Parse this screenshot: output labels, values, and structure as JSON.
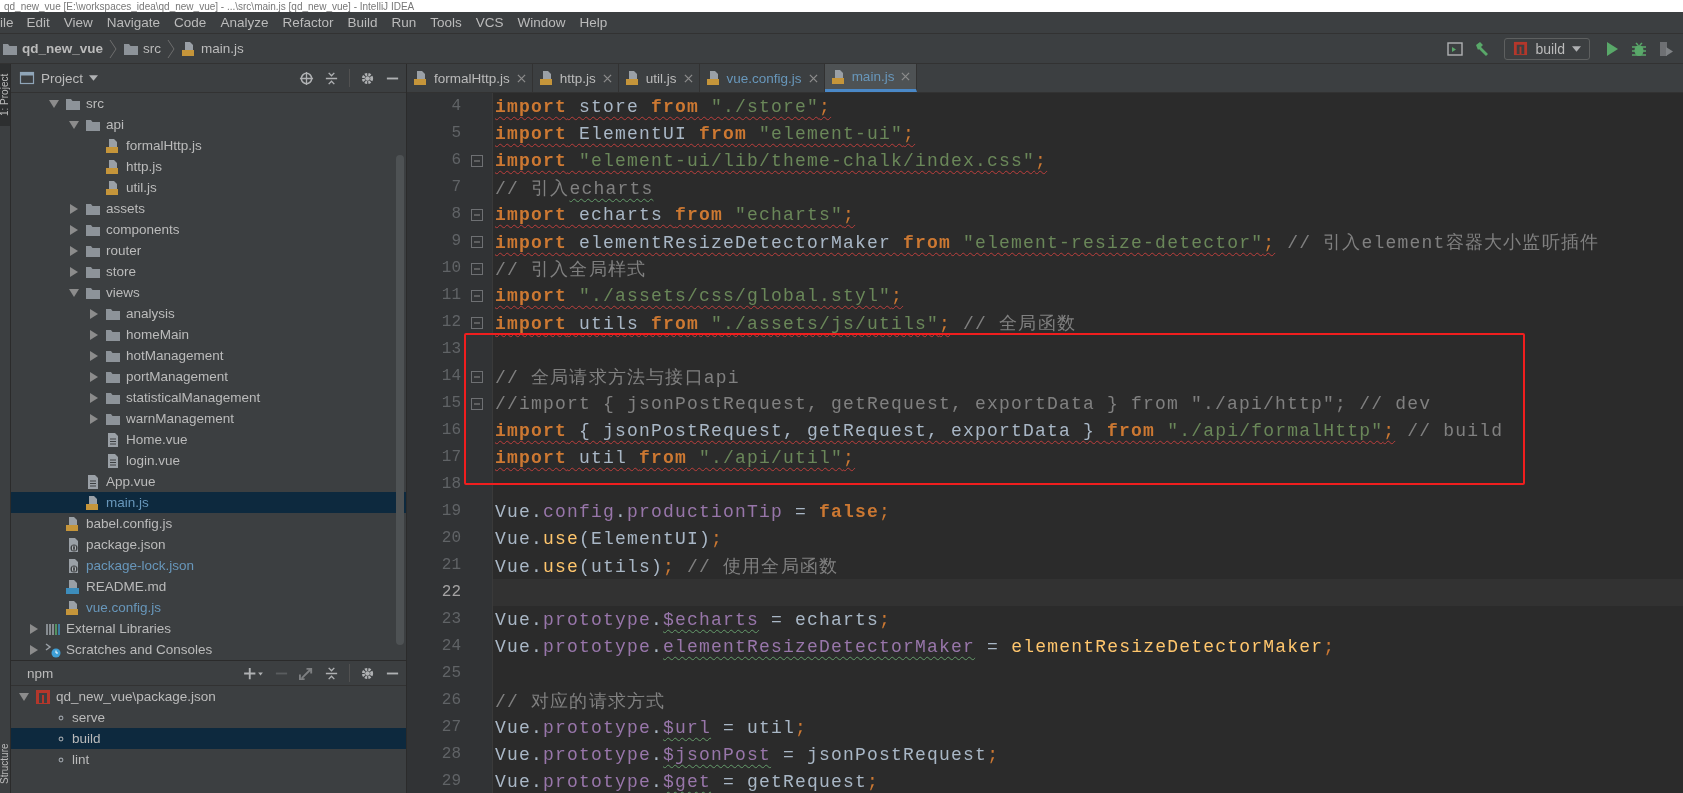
{
  "window": {
    "title": "qd_new_vue [E:\\workspaces_idea\\qd_new_vue] - ...\\src\\main.js [qd_new_vue] - IntelliJ IDEA"
  },
  "menu": [
    "ile",
    "Edit",
    "View",
    "Navigate",
    "Code",
    "Analyze",
    "Refactor",
    "Build",
    "Run",
    "Tools",
    "VCS",
    "Window",
    "Help"
  ],
  "breadcrumb": [
    {
      "kind": "project",
      "label": "qd_new_vue"
    },
    {
      "kind": "folder",
      "label": "src"
    },
    {
      "kind": "js",
      "label": "main.js"
    }
  ],
  "run_config": {
    "label": "build"
  },
  "side_tabs": {
    "top": "1: Project",
    "bottom": "Structure"
  },
  "project_panel": {
    "title": "Project"
  },
  "project_tree": {
    "items": [
      {
        "kind": "folder",
        "label": "src",
        "expanded": true,
        "selected": false,
        "children": [
          {
            "kind": "folder",
            "label": "api",
            "expanded": true,
            "selected": false,
            "children": [
              {
                "kind": "js",
                "label": "formalHttp.js",
                "selected": false,
                "modified": false
              },
              {
                "kind": "js",
                "label": "http.js",
                "selected": false,
                "modified": false
              },
              {
                "kind": "js",
                "label": "util.js",
                "selected": false,
                "modified": false
              }
            ]
          },
          {
            "kind": "folder",
            "label": "assets",
            "expanded": false,
            "selected": false
          },
          {
            "kind": "folder",
            "label": "components",
            "expanded": false,
            "selected": false
          },
          {
            "kind": "folder",
            "label": "router",
            "expanded": false,
            "selected": false
          },
          {
            "kind": "folder",
            "label": "store",
            "expanded": false,
            "selected": false
          },
          {
            "kind": "folder",
            "label": "views",
            "expanded": true,
            "selected": false,
            "children": [
              {
                "kind": "folder",
                "label": "analysis",
                "expanded": false,
                "selected": false
              },
              {
                "kind": "folder",
                "label": "homeMain",
                "expanded": false,
                "selected": false
              },
              {
                "kind": "folder",
                "label": "hotManagement",
                "expanded": false,
                "selected": false
              },
              {
                "kind": "folder",
                "label": "portManagement",
                "expanded": false,
                "selected": false
              },
              {
                "kind": "folder",
                "label": "statisticalManagement",
                "expanded": false,
                "selected": false
              },
              {
                "kind": "folder",
                "label": "warnManagement",
                "expanded": false,
                "selected": false
              },
              {
                "kind": "vue",
                "label": "Home.vue",
                "selected": false,
                "modified": false
              },
              {
                "kind": "vue",
                "label": "login.vue",
                "selected": false,
                "modified": false
              }
            ]
          },
          {
            "kind": "vue",
            "label": "App.vue",
            "selected": false,
            "modified": false
          },
          {
            "kind": "js",
            "label": "main.js",
            "selected": true,
            "modified": true
          }
        ]
      },
      {
        "kind": "js",
        "label": "babel.config.js",
        "selected": false,
        "modified": false
      },
      {
        "kind": "json",
        "label": "package.json",
        "selected": false,
        "modified": false
      },
      {
        "kind": "json",
        "label": "package-lock.json",
        "selected": false,
        "modified": true
      },
      {
        "kind": "md",
        "label": "README.md",
        "selected": false,
        "modified": false
      },
      {
        "kind": "js",
        "label": "vue.config.js",
        "selected": false,
        "modified": true
      }
    ],
    "extra_items": [
      {
        "kind": "library",
        "label": "External Libraries",
        "expanded": false,
        "selected": false
      },
      {
        "kind": "scratch",
        "label": "Scratches and Consoles",
        "expanded": false,
        "selected": false
      }
    ]
  },
  "npm_panel": {
    "title": "npm",
    "items": [
      {
        "kind": "package",
        "label": "qd_new_vue\\package.json",
        "expanded": true,
        "selected": false,
        "children": [
          {
            "kind": "script",
            "label": "serve",
            "selected": false
          },
          {
            "kind": "script",
            "label": "build",
            "selected": true
          },
          {
            "kind": "script",
            "label": "lint",
            "selected": false
          }
        ]
      }
    ]
  },
  "tabs": [
    {
      "label": "formalHttp.js",
      "selected": false,
      "modified": false
    },
    {
      "label": "http.js",
      "selected": false,
      "modified": false
    },
    {
      "label": "util.js",
      "selected": false,
      "modified": false
    },
    {
      "label": "vue.config.js",
      "selected": false,
      "modified": true
    },
    {
      "label": "main.js",
      "selected": true,
      "modified": true
    }
  ],
  "code_lines": [
    {
      "number": "4",
      "error": true,
      "tokens": [
        {
          "kind": "keyword",
          "text": "import"
        },
        {
          "kind": "plain",
          "text": " store "
        },
        {
          "kind": "keyword",
          "text": "from"
        },
        {
          "kind": "string",
          "text": " \"./store\""
        },
        {
          "kind": "punct",
          "text": ";"
        }
      ]
    },
    {
      "number": "5",
      "error": true,
      "tokens": [
        {
          "kind": "keyword",
          "text": "import"
        },
        {
          "kind": "plain",
          "text": " ElementUI "
        },
        {
          "kind": "keyword",
          "text": "from"
        },
        {
          "kind": "string",
          "text": " \"element-ui\""
        },
        {
          "kind": "punct",
          "text": ";"
        }
      ]
    },
    {
      "number": "6",
      "error": true,
      "fold": true,
      "tokens": [
        {
          "kind": "keyword",
          "text": "import"
        },
        {
          "kind": "string",
          "text": " \"element-ui/lib/theme-chalk/index.css\""
        },
        {
          "kind": "punct",
          "text": ";"
        }
      ]
    },
    {
      "number": "7",
      "tokens": [
        {
          "kind": "comment",
          "text": "// 引入"
        },
        {
          "kind": "comment",
          "text": "echarts",
          "typo": true
        }
      ]
    },
    {
      "number": "8",
      "error": true,
      "fold": true,
      "tokens": [
        {
          "kind": "keyword",
          "text": "import"
        },
        {
          "kind": "plain",
          "text": " echarts "
        },
        {
          "kind": "keyword",
          "text": "from"
        },
        {
          "kind": "string",
          "text": " \"echarts\""
        },
        {
          "kind": "punct",
          "text": ";"
        }
      ]
    },
    {
      "number": "9",
      "error": true,
      "fold": true,
      "tokens": [
        {
          "kind": "keyword",
          "text": "import"
        },
        {
          "kind": "plain",
          "text": " elementResizeDetectorMaker "
        },
        {
          "kind": "keyword",
          "text": "from"
        },
        {
          "kind": "string",
          "text": " \"element-resize-detector\""
        },
        {
          "kind": "punct",
          "text": ";"
        },
        {
          "kind": "comment",
          "text": " // 引入element容器大小监听插件"
        }
      ]
    },
    {
      "number": "10",
      "fold": true,
      "tokens": [
        {
          "kind": "comment",
          "text": "// 引入全局样式"
        }
      ]
    },
    {
      "number": "11",
      "error": true,
      "fold": true,
      "tokens": [
        {
          "kind": "keyword",
          "text": "import"
        },
        {
          "kind": "string",
          "text": " \"./assets/css/global.styl\""
        },
        {
          "kind": "punct",
          "text": ";"
        }
      ]
    },
    {
      "number": "12",
      "error": true,
      "fold": true,
      "tokens": [
        {
          "kind": "keyword",
          "text": "import"
        },
        {
          "kind": "plain",
          "text": " utils "
        },
        {
          "kind": "keyword",
          "text": "from"
        },
        {
          "kind": "string",
          "text": " \"./assets/js/utils\""
        },
        {
          "kind": "punct",
          "text": ";"
        },
        {
          "kind": "comment",
          "text": " // 全局函数"
        }
      ]
    },
    {
      "number": "13",
      "boxed": true
    },
    {
      "number": "14",
      "boxed": true,
      "fold": true,
      "tokens": [
        {
          "kind": "comment",
          "text": "// 全局请求方法与接口api"
        }
      ]
    },
    {
      "number": "15",
      "boxed": true,
      "fold": true,
      "tokens": [
        {
          "kind": "comment",
          "text": "//import { jsonPostRequest, getRequest, exportData } from \"./api/http\"; // dev"
        }
      ]
    },
    {
      "number": "16",
      "boxed": true,
      "error": true,
      "tokens": [
        {
          "kind": "keyword",
          "text": "import"
        },
        {
          "kind": "plain",
          "text": " { jsonPostRequest, getRequest, exportData } "
        },
        {
          "kind": "keyword",
          "text": "from"
        },
        {
          "kind": "string",
          "text": " \"./api/formalHttp\""
        },
        {
          "kind": "punct",
          "text": ";"
        },
        {
          "kind": "comment",
          "text": " // build"
        }
      ]
    },
    {
      "number": "17",
      "boxed": true,
      "error": true,
      "tokens": [
        {
          "kind": "keyword",
          "text": "import"
        },
        {
          "kind": "plain",
          "text": " util "
        },
        {
          "kind": "keyword",
          "text": "from"
        },
        {
          "kind": "string",
          "text": " \"./api/util\""
        },
        {
          "kind": "punct",
          "text": ";"
        }
      ]
    },
    {
      "number": "18"
    },
    {
      "number": "19",
      "tokens": [
        {
          "kind": "plain",
          "text": "Vue."
        },
        {
          "kind": "property",
          "text": "config"
        },
        {
          "kind": "plain",
          "text": "."
        },
        {
          "kind": "property",
          "text": "productionTip"
        },
        {
          "kind": "plain",
          "text": " = "
        },
        {
          "kind": "keyword",
          "text": "false"
        },
        {
          "kind": "punct",
          "text": ";"
        }
      ]
    },
    {
      "number": "20",
      "tokens": [
        {
          "kind": "plain",
          "text": "Vue."
        },
        {
          "kind": "function",
          "text": "use"
        },
        {
          "kind": "plain",
          "text": "(ElementUI)"
        },
        {
          "kind": "punct",
          "text": ";"
        }
      ]
    },
    {
      "number": "21",
      "tokens": [
        {
          "kind": "plain",
          "text": "Vue."
        },
        {
          "kind": "function",
          "text": "use"
        },
        {
          "kind": "plain",
          "text": "(utils)"
        },
        {
          "kind": "punct",
          "text": ";"
        },
        {
          "kind": "comment",
          "text": " // 使用全局函数"
        }
      ]
    },
    {
      "number": "22",
      "current": true
    },
    {
      "number": "23",
      "tokens": [
        {
          "kind": "plain",
          "text": "Vue."
        },
        {
          "kind": "property",
          "text": "prototype"
        },
        {
          "kind": "plain",
          "text": "."
        },
        {
          "kind": "property",
          "text": "$echarts",
          "typo": true
        },
        {
          "kind": "plain",
          "text": " = echarts"
        },
        {
          "kind": "punct",
          "text": ";"
        }
      ]
    },
    {
      "number": "24",
      "tokens": [
        {
          "kind": "plain",
          "text": "Vue."
        },
        {
          "kind": "property",
          "text": "prototype"
        },
        {
          "kind": "plain",
          "text": "."
        },
        {
          "kind": "property",
          "text": "elementResizeDetectorMaker",
          "typo": true
        },
        {
          "kind": "plain",
          "text": " = "
        },
        {
          "kind": "function",
          "text": "elementResizeDetectorMaker"
        },
        {
          "kind": "punct",
          "text": ";"
        }
      ]
    },
    {
      "number": "25"
    },
    {
      "number": "26",
      "tokens": [
        {
          "kind": "comment",
          "text": "// 对应的请求方式"
        }
      ]
    },
    {
      "number": "27",
      "tokens": [
        {
          "kind": "plain",
          "text": "Vue."
        },
        {
          "kind": "property",
          "text": "prototype"
        },
        {
          "kind": "plain",
          "text": "."
        },
        {
          "kind": "property",
          "text": "$url",
          "typo": true
        },
        {
          "kind": "plain",
          "text": " = util"
        },
        {
          "kind": "punct",
          "text": ";"
        }
      ]
    },
    {
      "number": "28",
      "tokens": [
        {
          "kind": "plain",
          "text": "Vue."
        },
        {
          "kind": "property",
          "text": "prototype"
        },
        {
          "kind": "plain",
          "text": "."
        },
        {
          "kind": "property",
          "text": "$jsonPost",
          "typo": true
        },
        {
          "kind": "plain",
          "text": " = jsonPostRequest"
        },
        {
          "kind": "punct",
          "text": ";"
        }
      ]
    },
    {
      "number": "29",
      "tokens": [
        {
          "kind": "plain",
          "text": "Vue."
        },
        {
          "kind": "property",
          "text": "prototype"
        },
        {
          "kind": "plain",
          "text": "."
        },
        {
          "kind": "property",
          "text": "$get",
          "typo": true
        },
        {
          "kind": "plain",
          "text": " = getRequest"
        },
        {
          "kind": "punct",
          "text": ";"
        }
      ]
    }
  ]
}
